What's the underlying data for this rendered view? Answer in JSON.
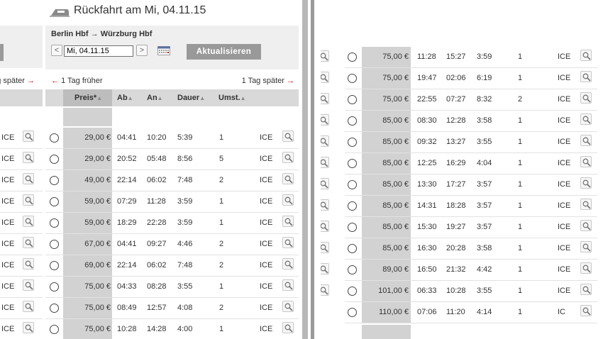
{
  "header": {
    "title": "Rückfahrt am  Mi, 04.11.15"
  },
  "route": {
    "from": "Berlin Hbf",
    "arrow": "→",
    "to": "Würzburg Hbf"
  },
  "date_picker": {
    "prev": "<",
    "value": "Mi, 04.11.15",
    "next": ">",
    "refresh_label": "Aktualisieren"
  },
  "day_nav": {
    "earlier_arrow": "←",
    "earlier_label": "1 Tag früher",
    "later_label": "1 Tag später",
    "later_arrow": "→"
  },
  "left_fragment": {
    "later_label": "g später",
    "later_arrow": "→",
    "products": [
      "ICE",
      "ICE",
      "ICE",
      "ICE",
      "ICE",
      "ICE",
      "ICE",
      "ICE",
      "ICE",
      "ICE"
    ]
  },
  "columns": {
    "price": "Preis*",
    "dep": "Ab",
    "arr": "An",
    "duration": "Dauer",
    "changes": "Umst.",
    "sort_arrow": "▲"
  },
  "main_rows": [
    {
      "price": "29,00 €",
      "dep": "04:41",
      "arr": "10:20",
      "dur": "5:39",
      "chg": "1",
      "prod": "ICE"
    },
    {
      "price": "29,00 €",
      "dep": "20:52",
      "arr": "05:48",
      "dur": "8:56",
      "chg": "5",
      "prod": "ICE"
    },
    {
      "price": "49,00 €",
      "dep": "22:14",
      "arr": "06:02",
      "dur": "7:48",
      "chg": "2",
      "prod": "ICE"
    },
    {
      "price": "59,00 €",
      "dep": "07:29",
      "arr": "11:28",
      "dur": "3:59",
      "chg": "1",
      "prod": "ICE"
    },
    {
      "price": "59,00 €",
      "dep": "18:29",
      "arr": "22:28",
      "dur": "3:59",
      "chg": "1",
      "prod": "ICE"
    },
    {
      "price": "67,00 €",
      "dep": "04:41",
      "arr": "09:27",
      "dur": "4:46",
      "chg": "2",
      "prod": "ICE"
    },
    {
      "price": "69,00 €",
      "dep": "22:14",
      "arr": "06:02",
      "dur": "7:48",
      "chg": "2",
      "prod": "ICE"
    },
    {
      "price": "75,00 €",
      "dep": "04:33",
      "arr": "08:28",
      "dur": "3:55",
      "chg": "1",
      "prod": "ICE"
    },
    {
      "price": "75,00 €",
      "dep": "08:49",
      "arr": "12:57",
      "dur": "4:08",
      "chg": "2",
      "prod": "ICE"
    },
    {
      "price": "75,00 €",
      "dep": "10:28",
      "arr": "14:28",
      "dur": "4:00",
      "chg": "1",
      "prod": "ICE"
    }
  ],
  "right_rows": [
    {
      "price": "75,00 €",
      "dep": "11:28",
      "arr": "15:27",
      "dur": "3:59",
      "chg": "1",
      "prod": "ICE"
    },
    {
      "price": "75,00 €",
      "dep": "19:47",
      "arr": "02:06",
      "dur": "6:19",
      "chg": "1",
      "prod": "ICE"
    },
    {
      "price": "75,00 €",
      "dep": "22:55",
      "arr": "07:27",
      "dur": "8:32",
      "chg": "2",
      "prod": "ICE"
    },
    {
      "price": "85,00 €",
      "dep": "08:30",
      "arr": "12:28",
      "dur": "3:58",
      "chg": "1",
      "prod": "ICE"
    },
    {
      "price": "85,00 €",
      "dep": "09:32",
      "arr": "13:27",
      "dur": "3:55",
      "chg": "1",
      "prod": "ICE"
    },
    {
      "price": "85,00 €",
      "dep": "12:25",
      "arr": "16:29",
      "dur": "4:04",
      "chg": "1",
      "prod": "ICE"
    },
    {
      "price": "85,00 €",
      "dep": "13:30",
      "arr": "17:27",
      "dur": "3:57",
      "chg": "1",
      "prod": "ICE"
    },
    {
      "price": "85,00 €",
      "dep": "14:31",
      "arr": "18:28",
      "dur": "3:57",
      "chg": "1",
      "prod": "ICE"
    },
    {
      "price": "85,00 €",
      "dep": "15:30",
      "arr": "19:27",
      "dur": "3:57",
      "chg": "1",
      "prod": "ICE"
    },
    {
      "price": "85,00 €",
      "dep": "16:30",
      "arr": "20:28",
      "dur": "3:58",
      "chg": "1",
      "prod": "ICE"
    },
    {
      "price": "89,00 €",
      "dep": "16:50",
      "arr": "21:32",
      "dur": "4:42",
      "chg": "1",
      "prod": "ICE"
    },
    {
      "price": "101,00 €",
      "dep": "06:33",
      "arr": "10:28",
      "dur": "3:55",
      "chg": "1",
      "prod": "ICE"
    },
    {
      "price": "110,00 €",
      "dep": "07:06",
      "arr": "11:20",
      "dur": "4:14",
      "chg": "1",
      "prod": "IC"
    }
  ],
  "icons": {
    "detail": "magnifier-icon",
    "train": "train-icon",
    "calendar": "calendar-icon"
  },
  "colors": {
    "accent_red": "#cc0000",
    "button_grey": "#999999",
    "price_column": "#d2d2d2",
    "panel_bg": "#efefef"
  }
}
